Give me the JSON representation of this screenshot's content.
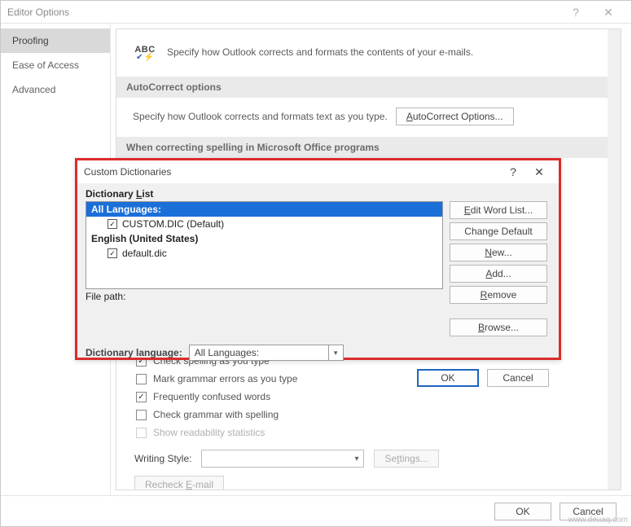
{
  "window": {
    "title": "Editor Options",
    "help_glyph": "?",
    "close_glyph": "✕"
  },
  "sidebar": {
    "items": [
      {
        "label": "Proofing",
        "active": true
      },
      {
        "label": "Ease of Access",
        "active": false
      },
      {
        "label": "Advanced",
        "active": false
      }
    ]
  },
  "intro": {
    "icon_text": "ABC",
    "text": "Specify how Outlook corrects and formats the contents of your e-mails."
  },
  "section_autocorrect": {
    "header": "AutoCorrect options",
    "text": "Specify how Outlook corrects and formats text as you type.",
    "button": "AutoCorrect Options..."
  },
  "section_spelling": {
    "header": "When correcting spelling in Microsoft Office programs"
  },
  "checkboxes": [
    {
      "label": "Check spelling as you type",
      "checked": true,
      "enabled": true
    },
    {
      "label": "Mark grammar errors as you type",
      "checked": false,
      "enabled": true
    },
    {
      "label": "Frequently confused words",
      "checked": true,
      "enabled": true
    },
    {
      "label": "Check grammar with spelling",
      "checked": false,
      "enabled": true
    },
    {
      "label": "Show readability statistics",
      "checked": false,
      "enabled": false
    }
  ],
  "writing_style": {
    "label": "Writing Style:",
    "value": "",
    "settings_btn": "Settings..."
  },
  "recheck_btn": "Recheck E-mail",
  "footer": {
    "ok": "OK",
    "cancel": "Cancel"
  },
  "modal": {
    "title": "Custom Dictionaries",
    "help_glyph": "?",
    "close_glyph": "✕",
    "dict_list_label": "Dictionary List",
    "list": {
      "group1_header": "All Languages:",
      "group1_items": [
        {
          "label": "CUSTOM.DIC (Default)",
          "checked": true
        }
      ],
      "group2_header": "English (United States)",
      "group2_items": [
        {
          "label": "default.dic",
          "checked": true
        }
      ]
    },
    "file_path_label": "File path:",
    "dict_lang_label": "Dictionary language:",
    "dict_lang_value": "All Languages:",
    "buttons": {
      "edit": "Edit Word List...",
      "change_default": "Change Default",
      "new": "New...",
      "add": "Add...",
      "remove": "Remove",
      "browse": "Browse..."
    },
    "ok": "OK",
    "cancel": "Cancel"
  },
  "watermark": "www.deuaq.com"
}
